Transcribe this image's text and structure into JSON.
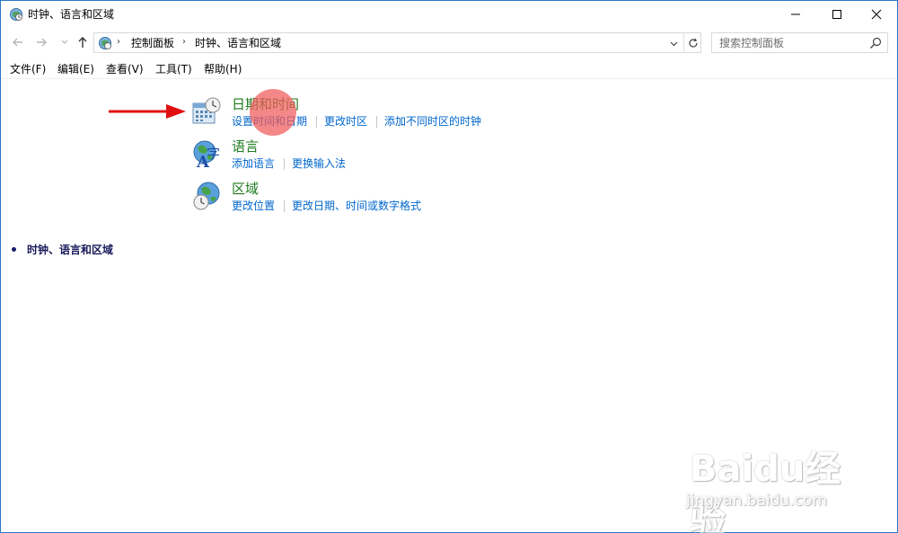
{
  "window": {
    "title": "时钟、语言和区域",
    "controls": {
      "minimize": "minimize",
      "maximize": "maximize",
      "close": "close"
    }
  },
  "address": {
    "crumbs": [
      "控制面板",
      "时钟、语言和区域"
    ],
    "separator": "›"
  },
  "search": {
    "placeholder": "搜索控制面板"
  },
  "menu": {
    "items": [
      "文件(F)",
      "编辑(E)",
      "查看(V)",
      "工具(T)",
      "帮助(H)"
    ]
  },
  "categories": [
    {
      "title": "日期和时间",
      "icon": "calendar-clock-icon",
      "links": [
        "设置时间和日期",
        "更改时区",
        "添加不同时区的时钟"
      ]
    },
    {
      "title": "语言",
      "icon": "language-globe-icon",
      "links": [
        "添加语言",
        "更换输入法"
      ]
    },
    {
      "title": "区域",
      "icon": "region-globe-icon",
      "links": [
        "更改位置",
        "更改日期、时间或数字格式"
      ]
    }
  ],
  "sidebar": {
    "items": [
      "时钟、语言和区域"
    ]
  },
  "watermark": {
    "line1": "Baidu经验",
    "line2": "jingyan.baidu.com"
  },
  "colors": {
    "link": "#0066cc",
    "category_title": "#1e7a1e",
    "highlight": "#f05a5a",
    "arrow": "#e01010",
    "window_border": "#2b78c5"
  }
}
